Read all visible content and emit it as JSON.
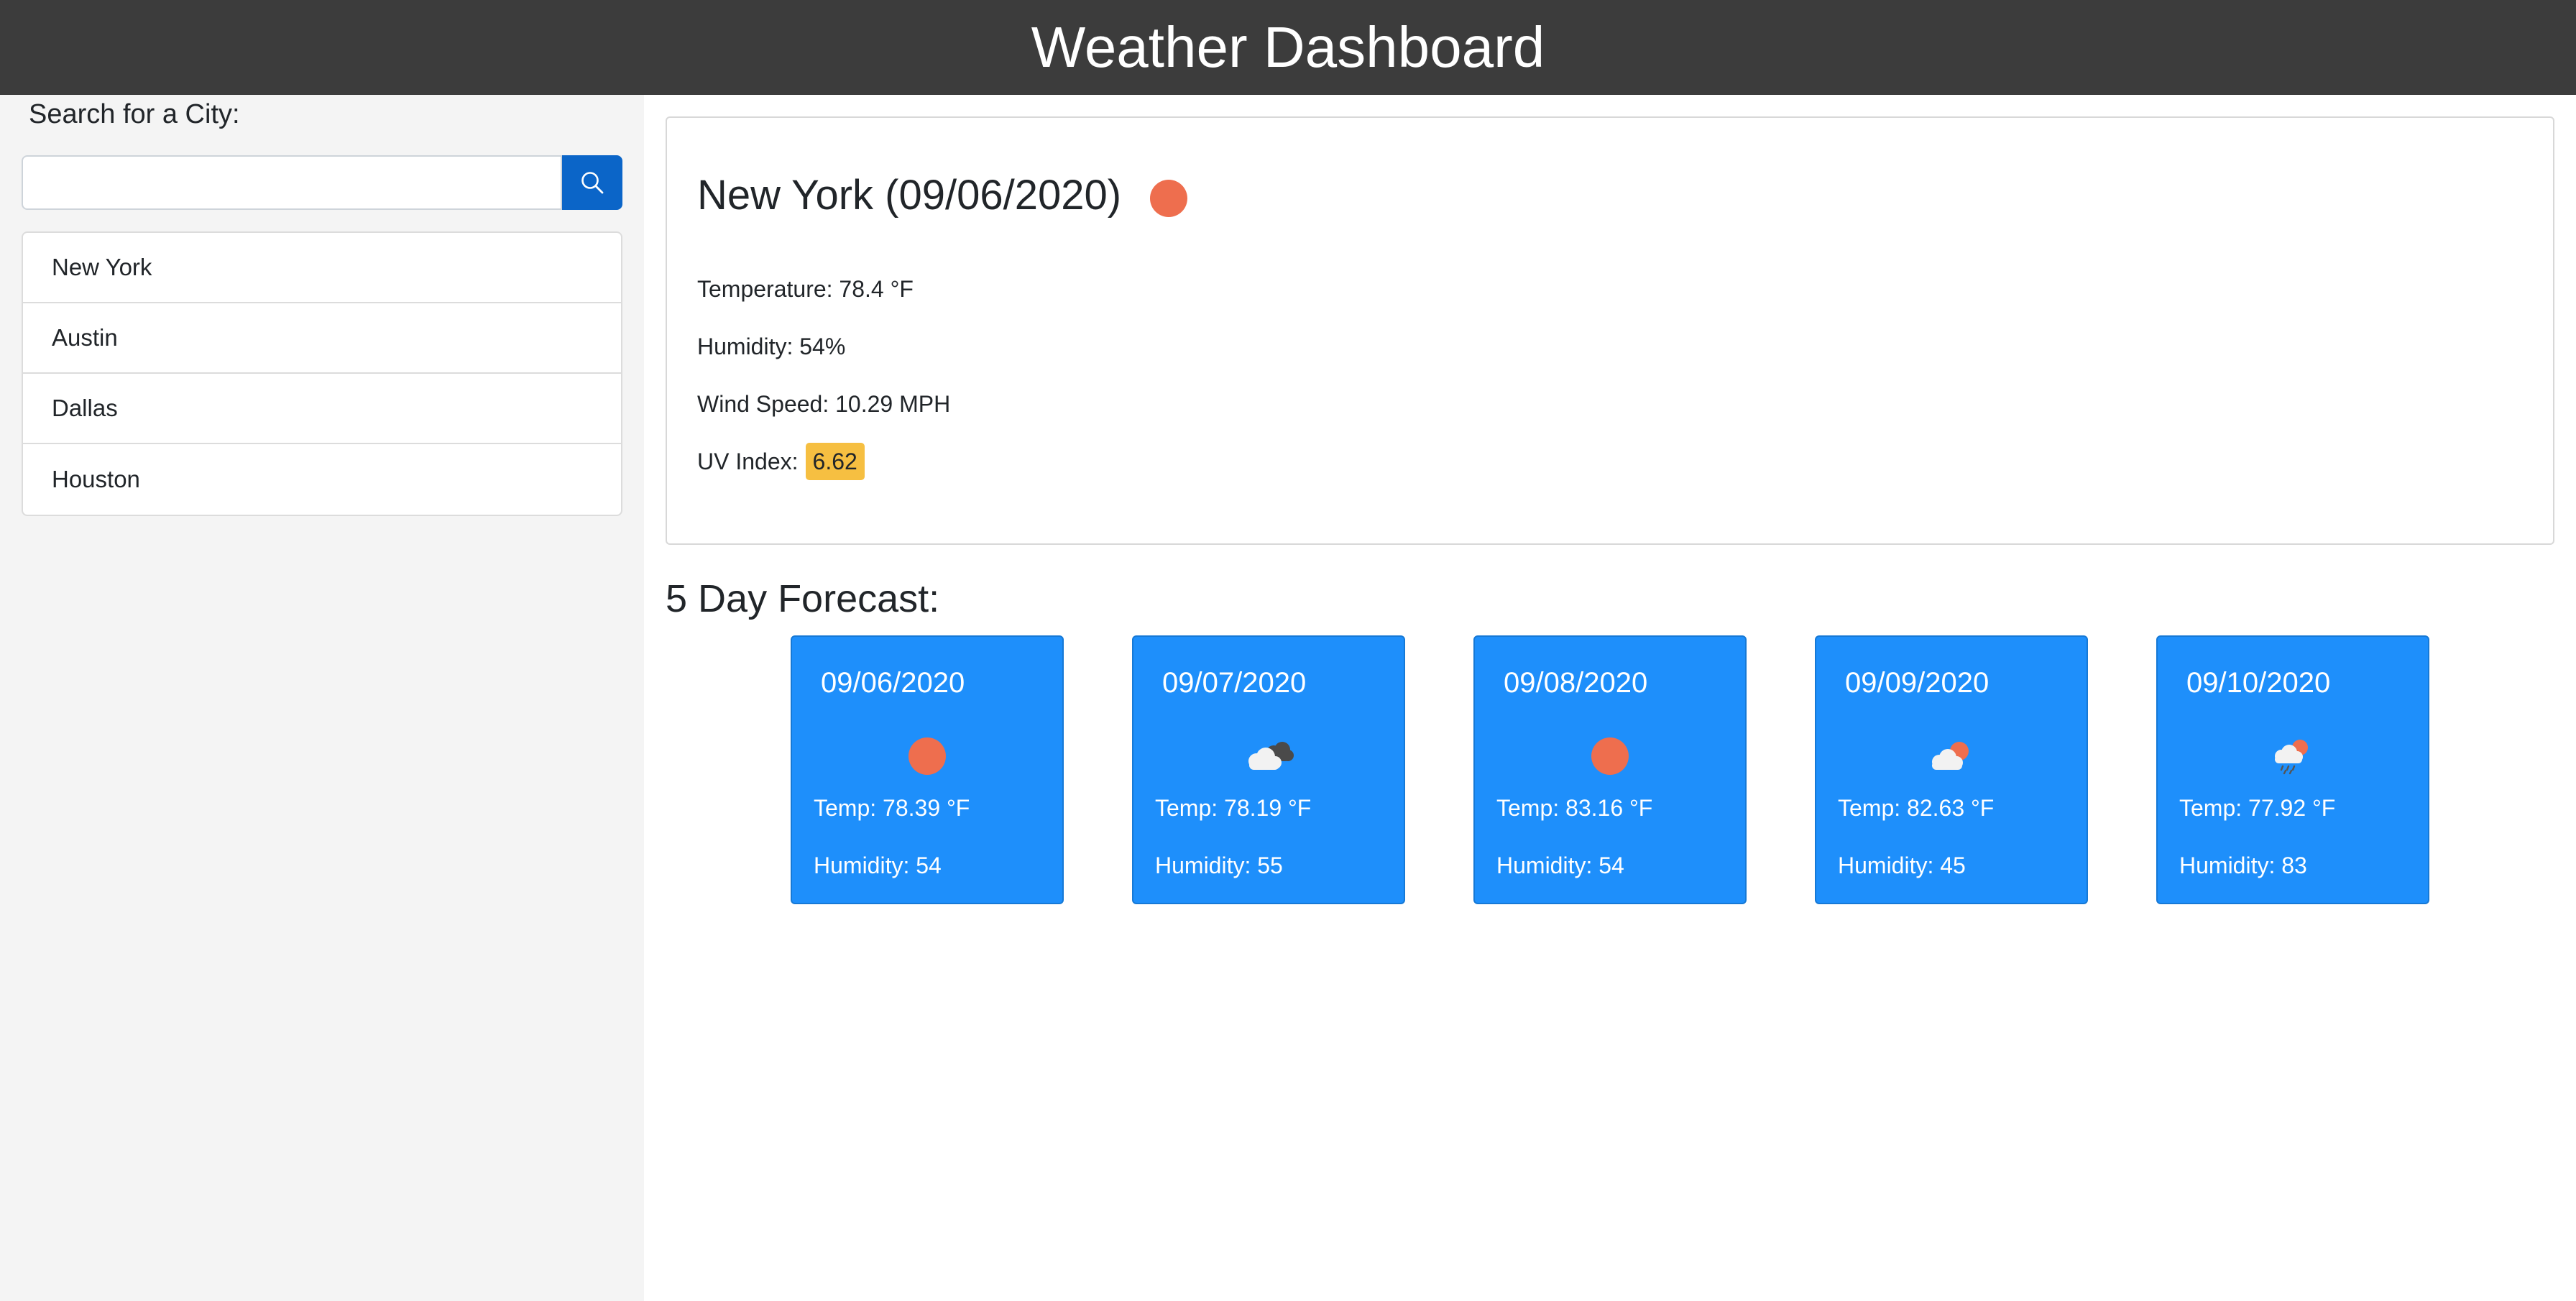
{
  "header": {
    "title": "Weather Dashboard"
  },
  "sidebar": {
    "search_label": "Search for a City:",
    "search_value": "",
    "search_placeholder": "",
    "search_icon": "search-icon",
    "cities": [
      "New York",
      "Austin",
      "Dallas",
      "Houston"
    ]
  },
  "current": {
    "heading": "New York (09/06/2020)",
    "icon": "sun-icon",
    "temperature": "Temperature: 78.4 °F",
    "humidity": "Humidity: 54%",
    "wind": "Wind Speed: 10.29 MPH",
    "uv_label": "UV Index:",
    "uv_value": "6.62",
    "uv_color": "#f6bf41"
  },
  "forecast": {
    "title": "5 Day Forecast:",
    "days": [
      {
        "date": "09/06/2020",
        "icon": "sun-icon",
        "temp": "Temp: 78.39 °F",
        "humidity": "Humidity: 54"
      },
      {
        "date": "09/07/2020",
        "icon": "broken-clouds-icon",
        "temp": "Temp: 78.19 °F",
        "humidity": "Humidity: 55"
      },
      {
        "date": "09/08/2020",
        "icon": "sun-icon",
        "temp": "Temp: 83.16 °F",
        "humidity": "Humidity: 54"
      },
      {
        "date": "09/09/2020",
        "icon": "partly-cloudy-icon",
        "temp": "Temp: 82.63 °F",
        "humidity": "Humidity: 45"
      },
      {
        "date": "09/10/2020",
        "icon": "rain-cloud-sun-icon",
        "temp": "Temp: 77.92 °F",
        "humidity": "Humidity: 83"
      }
    ]
  },
  "colors": {
    "header_bg": "#3c3c3c",
    "card_blue": "#1e8ffb",
    "button_blue": "#0b65c8",
    "sun": "#ee6e4e",
    "uv_badge": "#f6bf41"
  }
}
